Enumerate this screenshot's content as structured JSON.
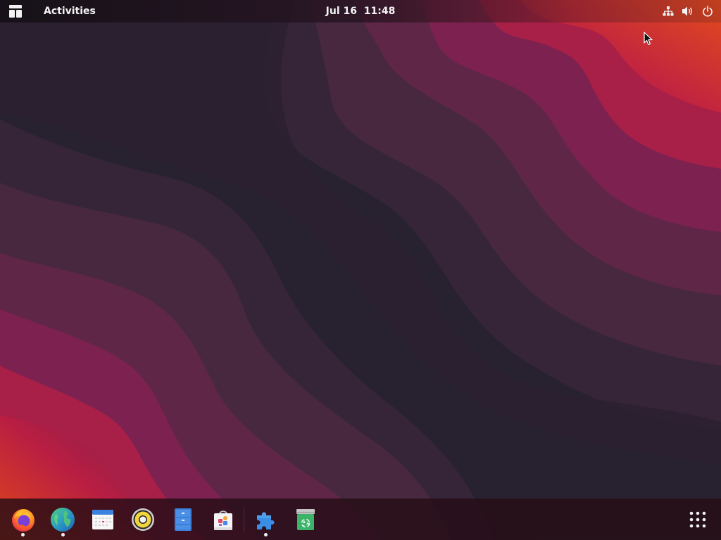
{
  "topbar": {
    "layout_icon": "workspace-layout-icon",
    "activities_label": "Activities",
    "clock": {
      "date": "Jul 16",
      "time": "11:48"
    },
    "system_icons": [
      "network-wired-icon",
      "volume-icon",
      "power-icon"
    ]
  },
  "dock": {
    "apps": [
      {
        "name": "firefox",
        "icon": "firefox-icon",
        "running": true
      },
      {
        "name": "web",
        "icon": "globe-icon",
        "running": true
      },
      {
        "name": "calendar",
        "icon": "calendar-icon",
        "running": false
      },
      {
        "name": "music",
        "icon": "speaker-icon",
        "running": false
      },
      {
        "name": "files",
        "icon": "file-cabinet-icon",
        "running": false
      },
      {
        "name": "software",
        "icon": "shopping-bag-icon",
        "running": false
      },
      {
        "name": "extensions",
        "icon": "puzzle-piece-icon",
        "running": true
      },
      {
        "name": "trash",
        "icon": "recycle-bin-icon",
        "running": false
      }
    ],
    "show_apps_icon": "app-grid-icon"
  },
  "colors": {
    "dark": "#282230",
    "plum": "#4e2548",
    "magenta": "#7b2252",
    "crimson": "#b01a45",
    "orange": "#d9451f"
  }
}
